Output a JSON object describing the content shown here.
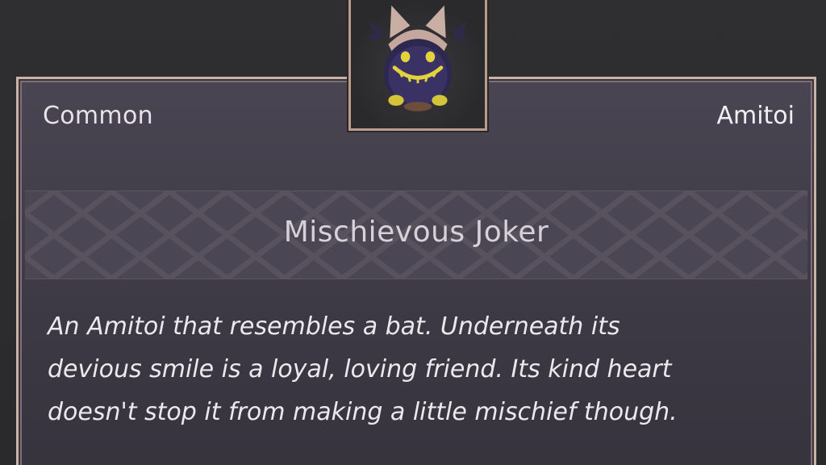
{
  "item": {
    "rarity": "Common",
    "category": "Amitoi",
    "name": "Mischievous Joker",
    "description_lines": [
      "An Amitoi that resembles a bat. Underneath its",
      "devious smile is a loyal, loving friend. Its kind heart",
      "doesn't stop it from making a little mischief though."
    ],
    "portrait_icon": "bat-amitoi-icon"
  },
  "colors": {
    "card_border": "#c9b3a6",
    "card_background": "#403c48",
    "text": "#ece9ee"
  }
}
